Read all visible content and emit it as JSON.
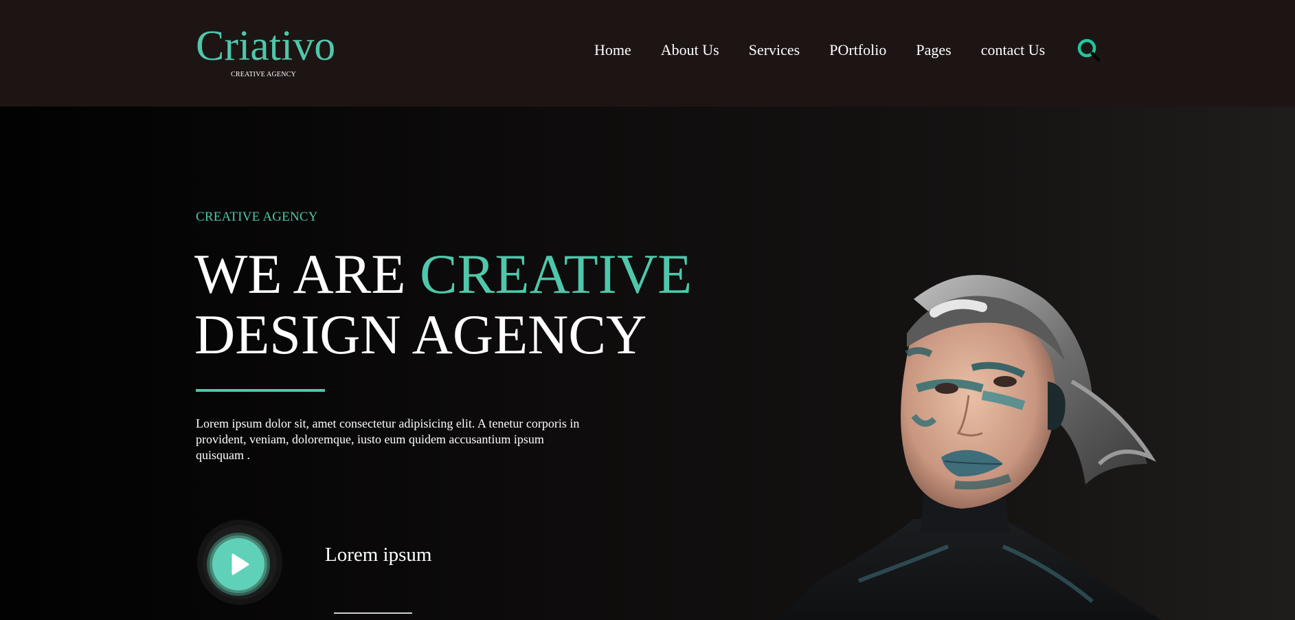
{
  "brand": {
    "name": "Criativo",
    "tagline": "CREATIVE AGENCY"
  },
  "nav": {
    "items": [
      "Home",
      "About Us",
      "Services",
      "POrtfolio",
      "Pages",
      "contact Us"
    ],
    "search_icon": "search-icon"
  },
  "hero": {
    "eyebrow": "CREATIVE AGENCY",
    "headline_part1": "WE ARE ",
    "headline_accent": "CREATIVE",
    "headline_line2": "DESIGN AGENCY",
    "description": "Lorem ipsum dolor sit, amet consectetur adipisicing elit. A tenetur corporis in provident, veniam, doloremque, iusto eum quidem accusantium ipsum quisquam .",
    "video_label": "Lorem ipsum",
    "play_icon": "play-icon"
  },
  "colors": {
    "accent": "#4fc7aa",
    "header_bg": "#1d1514",
    "text": "#ffffff"
  }
}
